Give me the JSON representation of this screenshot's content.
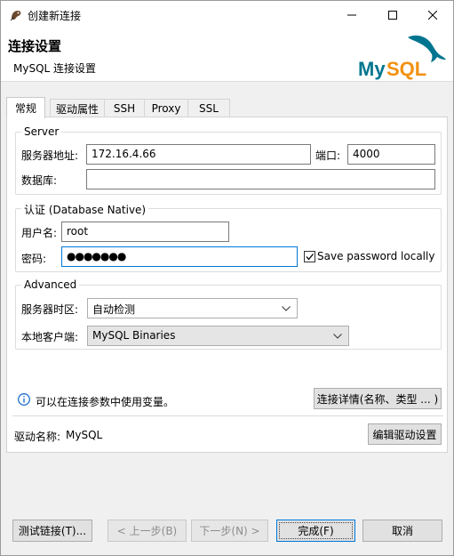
{
  "window": {
    "title": "创建新连接",
    "minimize_glyph": "—",
    "maximize_glyph": "☐",
    "close_glyph": "✕"
  },
  "header": {
    "title": "连接设置",
    "subtitle": "MySQL 连接设置",
    "logo_text": "MySQL"
  },
  "tabs": [
    {
      "label": "常规",
      "active": true
    },
    {
      "label": "驱动属性",
      "active": false
    },
    {
      "label": "SSH",
      "active": false
    },
    {
      "label": "Proxy",
      "active": false
    },
    {
      "label": "SSL",
      "active": false
    }
  ],
  "server": {
    "legend": "Server",
    "host_label": "服务器地址:",
    "host_value": "172.16.4.66",
    "port_label": "端口:",
    "port_value": "4000",
    "database_label": "数据库:",
    "database_value": ""
  },
  "auth": {
    "legend": "认证 (Database Native)",
    "username_label": "用户名:",
    "username_value": "root",
    "password_label": "密码:",
    "password_value": "●●●●●●●",
    "save_password_label": "Save password locally",
    "save_password_checked": true
  },
  "advanced": {
    "legend": "Advanced",
    "timezone_label": "服务器时区:",
    "timezone_value": "自动检测",
    "client_label": "本地客户端:",
    "client_value": "MySQL Binaries"
  },
  "info": {
    "text": "可以在连接参数中使用变量。",
    "details_button": "连接详情(名称、类型 ... )"
  },
  "driver": {
    "label": "驱动名称:",
    "value": "MySQL",
    "edit_button": "编辑驱动设置"
  },
  "footer": {
    "test_button": "测试链接(T)...",
    "back_button": "< 上一步(B)",
    "next_button": "下一步(N) >",
    "finish_button": "完成(F)",
    "cancel_button": "取消"
  },
  "colors": {
    "accent": "#0078d7",
    "mysql_blue": "#00758f",
    "mysql_orange": "#f29111",
    "info_icon": "#1e6fc9"
  }
}
